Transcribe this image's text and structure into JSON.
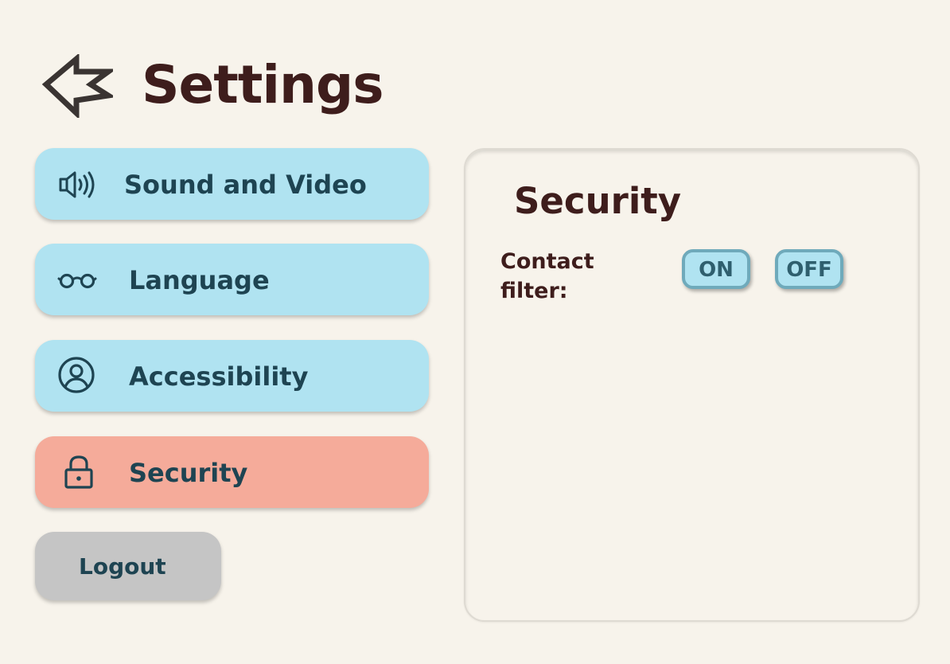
{
  "header": {
    "back_icon": "back-arrow-icon",
    "title": "Settings"
  },
  "sidebar": {
    "items": [
      {
        "label": "Sound and Video",
        "icon": "speaker-icon",
        "active": false
      },
      {
        "label": "Language",
        "icon": "glasses-icon",
        "active": false
      },
      {
        "label": "Accessibility",
        "icon": "user-circle-icon",
        "active": false
      },
      {
        "label": "Security",
        "icon": "lock-icon",
        "active": true
      }
    ],
    "logout_label": "Logout"
  },
  "panel": {
    "title": "Security",
    "settings": [
      {
        "label": "Contact filter:",
        "options": [
          "ON",
          "OFF"
        ]
      }
    ]
  },
  "colors": {
    "background": "#f7f3eb",
    "title_text": "#3e1d1c",
    "nav_item": "#b0e3f1",
    "nav_active": "#f5ab9a",
    "nav_text": "#1e4452",
    "logout": "#c5c5c5",
    "toggle_border": "#6faabb"
  }
}
